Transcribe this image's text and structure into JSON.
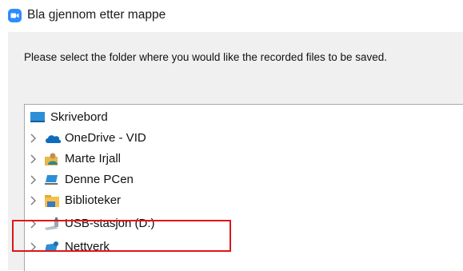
{
  "window": {
    "title": "Bla gjennom etter mappe",
    "app_icon": "zoom-camera-icon",
    "accent": "#2d8cff"
  },
  "dialog": {
    "instruction": "Please select the folder where you would like the recorded files to be saved."
  },
  "tree": {
    "items": [
      {
        "label": "Skrivebord",
        "icon": "desktop-icon",
        "expandable": false
      },
      {
        "label": "OneDrive - VID",
        "icon": "onedrive-cloud-icon",
        "expandable": true
      },
      {
        "label": "Marte Irjall",
        "icon": "user-folder-icon",
        "expandable": true
      },
      {
        "label": "Denne PCen",
        "icon": "computer-icon",
        "expandable": true
      },
      {
        "label": "Biblioteker",
        "icon": "library-folder-icon",
        "expandable": true
      },
      {
        "label": "USB-stasjon (D:)",
        "icon": "usb-drive-icon",
        "expandable": true,
        "highlighted": true
      },
      {
        "label": "Nettverk",
        "icon": "network-icon",
        "expandable": true
      }
    ]
  },
  "highlight_color": "#e0141a"
}
